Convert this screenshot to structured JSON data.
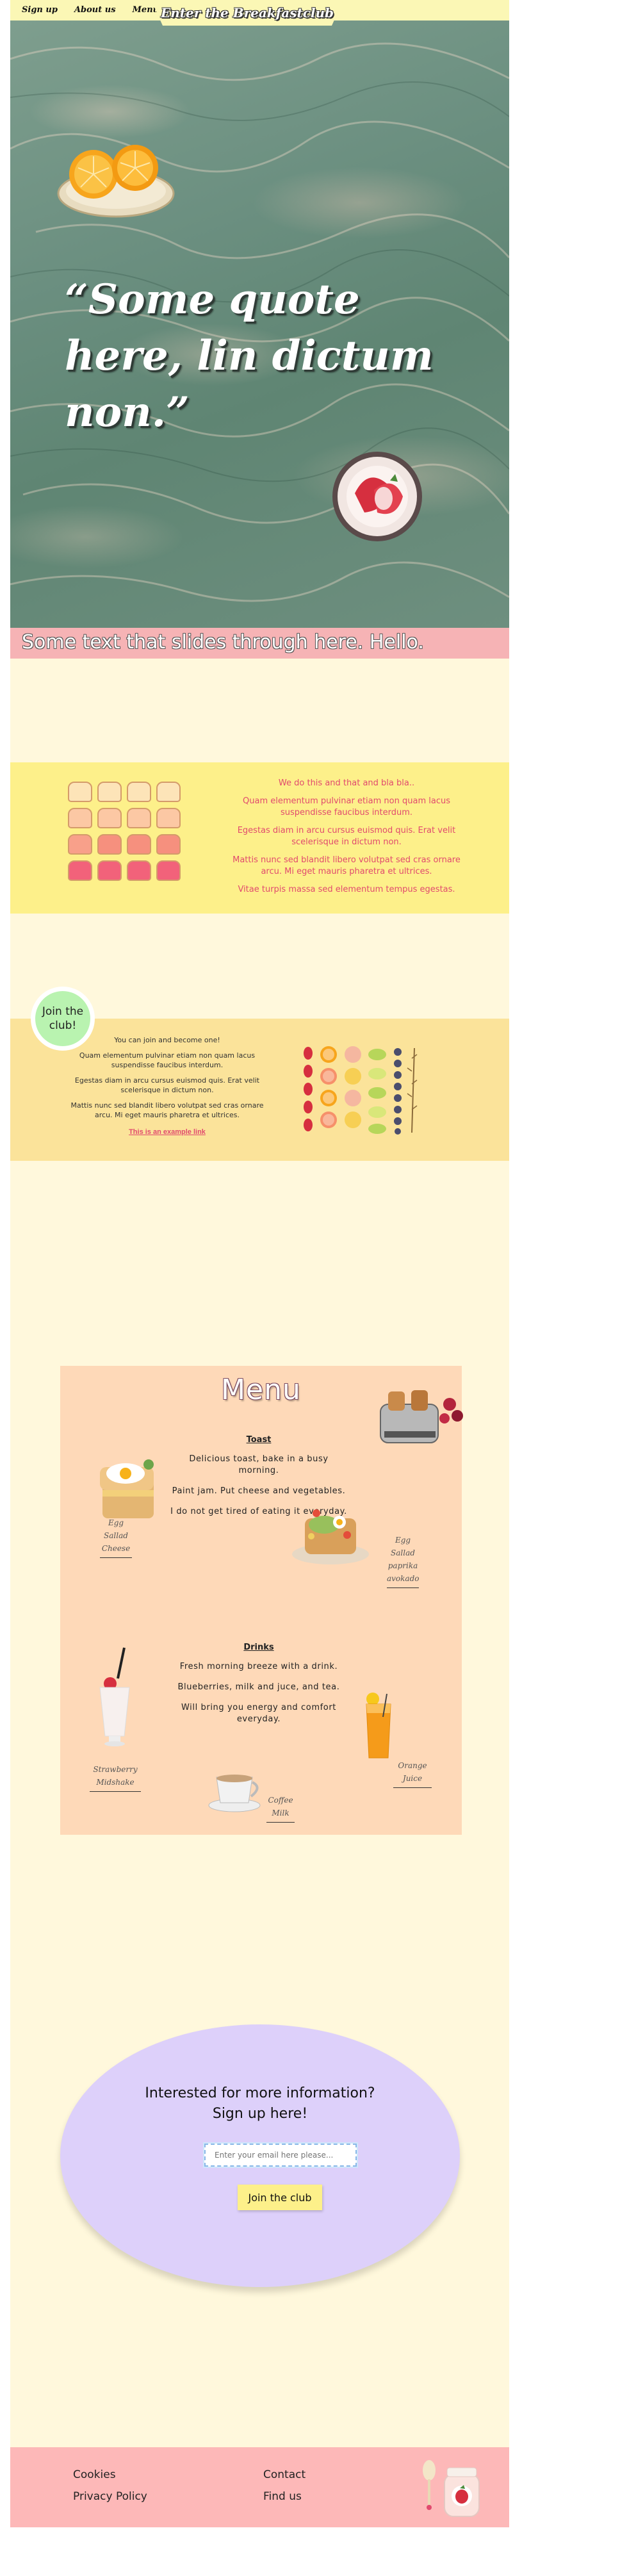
{
  "nav": {
    "links": [
      "Sign up",
      "About us",
      "Menu"
    ],
    "brand": "Enter the Breakfastclub"
  },
  "hero": {
    "quote": "“Some quote here, lin dictum non.”",
    "marquee": "Some text that slides through here. Hello."
  },
  "feature": {
    "lines": [
      "We do this and that and bla bla..",
      "Quam elementum pulvinar etiam non quam lacus suspendisse faucibus interdum.",
      "Egestas diam in arcu cursus euismod quis. Erat velit scelerisque in dictum non.",
      "Mattis nunc sed blandit libero volutpat sed cras ornare arcu. Mi eget mauris pharetra et ultrices.",
      "Vitae turpis massa sed elementum tempus egestas."
    ]
  },
  "join": {
    "badge": "Join the club!",
    "lines": [
      "You can join and become one!",
      "Quam elementum pulvinar etiam non quam lacus suspendisse faucibus interdum.",
      "Egestas diam in arcu cursus euismod quis. Erat velit scelerisque in dictum non.",
      "Mattis nunc sed blandit libero volutpat sed cras ornare arcu. Mi eget mauris pharetra et ultrices."
    ],
    "link": "This is an example link"
  },
  "menu": {
    "title": "Menu",
    "toast": {
      "heading": "Toast",
      "lines": [
        "Delicious toast, bake in a busy morning.",
        "Paint jam. Put cheese and vegetables.",
        "I do not get tired of eating it everyday."
      ],
      "captions": [
        "Egg Sallad Cheese",
        "Egg Sallad paprika avokado"
      ]
    },
    "drinks": {
      "heading": "Drinks",
      "lines": [
        "Fresh morning breeze with a drink.",
        "Blueberries, milk and juce, and tea.",
        "Will bring you energy and comfort everyday."
      ],
      "captions": [
        "Strawberry Midshake",
        "Coffee Milk",
        "Orange Juice"
      ]
    }
  },
  "signup": {
    "title_line1": "Interested for more information?",
    "title_line2": "Sign up here!",
    "email_placeholder": "Enter your email here please...",
    "button": "Join the club"
  },
  "footer": {
    "col1": [
      "Cookies",
      "Privacy Policy"
    ],
    "col2": [
      "Contact",
      "Find us"
    ]
  },
  "colors": {
    "page_bg": "#fff8dc",
    "nav_bg": "#fbf7b5",
    "marquee_bg": "#f6b3b5",
    "feature_bg": "#fdf08a",
    "feature_text": "#e14a6e",
    "join_band_bg": "#fbe39a",
    "join_badge": "#b9f3b0",
    "menu_bg": "#fed9b8",
    "signup_bg": "#ddd0fa",
    "footer_bg": "#fdb8b8"
  }
}
